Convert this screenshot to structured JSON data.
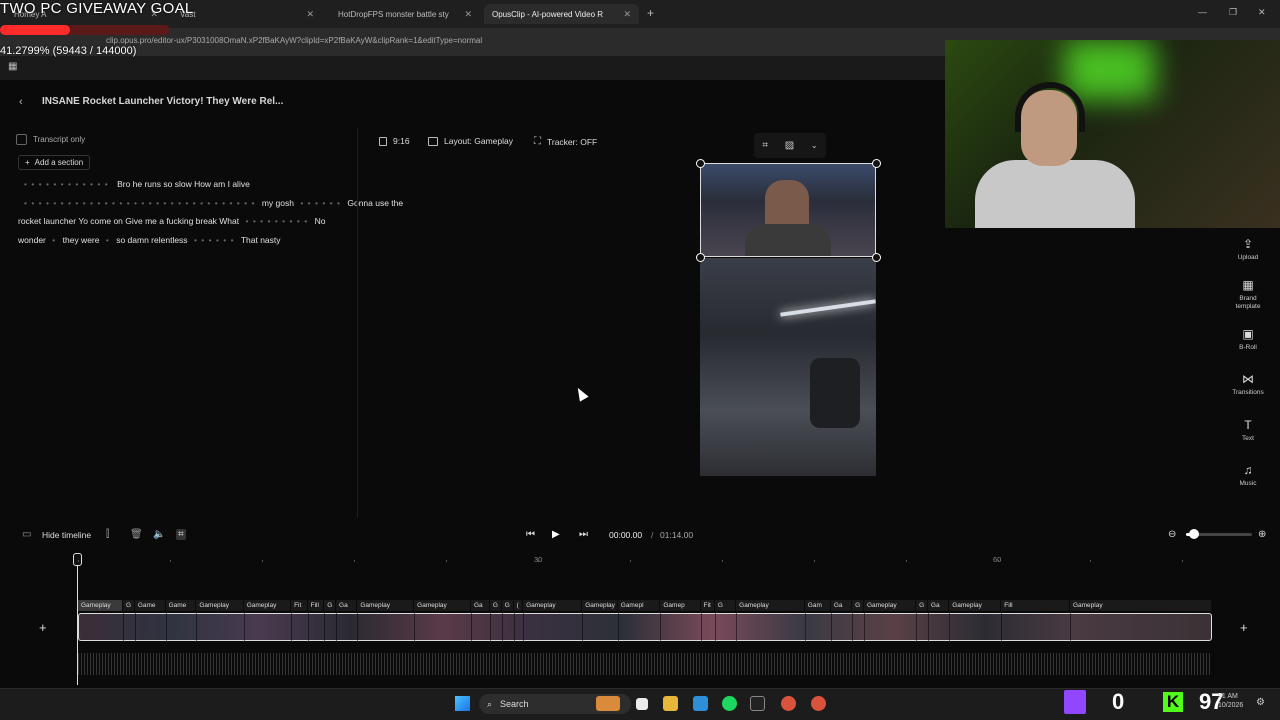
{
  "browser": {
    "tabs": [
      {
        "label": "Homey A",
        "active": false
      },
      {
        "label": "Vast",
        "active": false
      },
      {
        "label": "HotDropFPS monster battle sty",
        "active": false
      },
      {
        "label": "OpusClip - AI-powered Video R",
        "active": true
      }
    ],
    "new_tab": "+",
    "url": "clip.opus.pro/editor-ux/P3031008OmaN.xP2fBaKAyW?clipId=xP2fBaKAyW&clipRank=1&editType=normal",
    "window_controls": [
      "—",
      "❐",
      "✕"
    ]
  },
  "overlay": {
    "giveaway_title": "TWO PC GIVEAWAY GOAL",
    "progress_fraction": 0.412799,
    "progress_text": "41.2799% (59443 / 144000)"
  },
  "editor": {
    "back": "‹",
    "title": "INSANE Rocket Launcher Victory! They Were Rel...",
    "transcript_only": "Transcript only",
    "add_section": "Add a section",
    "transcript": [
      {
        "dots": "• • • • • • • • • • • •",
        "text": "Bro he runs so slow How am I alive"
      },
      {
        "dots": "• • • • • • • • • • • • • • • • • • • • • • • • • • • • • • • •",
        "text": "my gosh",
        "dots2": "• • • • • •",
        "text2": "Gonna use the"
      },
      {
        "text": "rocket launcher Yo come on Give me a fucking break What",
        "dots": "• • • • • • • • •",
        "text2": "No"
      },
      {
        "text": "wonder",
        "text2": "they were",
        "text3": "so damn relentless",
        "dots": "• • • • • •",
        "text4": "That nasty"
      }
    ],
    "toolbar": {
      "aspect": "9:16",
      "layout": "Layout: Gameplay",
      "tracker": "Tracker: OFF"
    },
    "sidebar": [
      {
        "icon": "upload-icon",
        "glyph": "⇪",
        "label": "Upload"
      },
      {
        "icon": "brand-template-icon",
        "glyph": "▦",
        "label": "Brand template"
      },
      {
        "icon": "b-roll-icon",
        "glyph": "▣",
        "label": "B-Roll"
      },
      {
        "icon": "transitions-icon",
        "glyph": "⋈",
        "label": "Transitions"
      },
      {
        "icon": "text-icon",
        "glyph": "T",
        "label": "Text"
      },
      {
        "icon": "music-icon",
        "glyph": "♫",
        "label": "Music"
      }
    ]
  },
  "timeline": {
    "hide_label": "Hide timeline",
    "current_time": "00:00.00",
    "separator": "/",
    "total_time": "01:14.00",
    "ruler_labels": [
      "30",
      "60"
    ],
    "clip_labels": [
      "Gameplay",
      "G",
      "Game",
      "Game",
      "Gameplay",
      "Gameplay",
      "Fit",
      "Fill",
      "G",
      "Ga",
      "Gameplay",
      "Gameplay",
      "Ga",
      "G",
      "G",
      "(",
      "Gameplay",
      "Gameplay",
      "Gamepl",
      "Gamep",
      "Fit",
      "G",
      "Gameplay",
      "Gam",
      "Ga",
      "G",
      "Gameplay",
      "G",
      "Ga",
      "Gameplay",
      "Fill",
      "Gameplay"
    ],
    "add_left": "+",
    "add_right": "+"
  },
  "taskbar": {
    "search_label": "Search",
    "twitch_count": "0",
    "kick_count": "97",
    "kick_letter": "K",
    "time": "51 AM",
    "date": "10/2026"
  }
}
